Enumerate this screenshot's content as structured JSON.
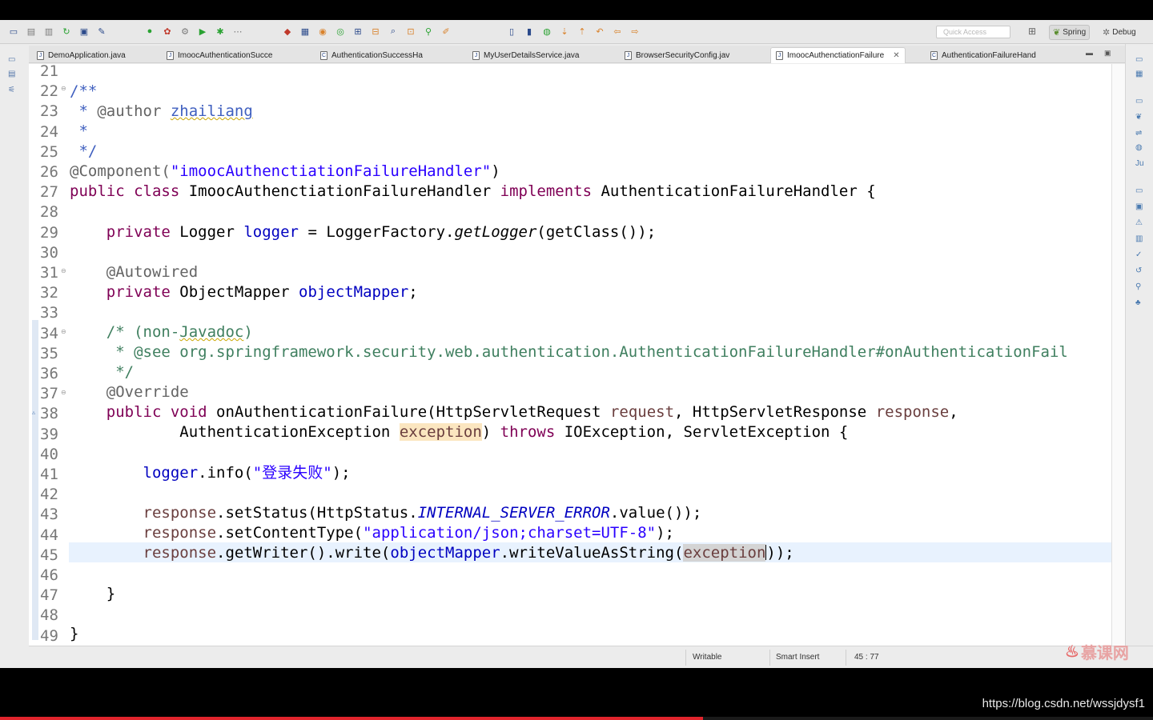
{
  "toolbar": {
    "quick_access_placeholder": "Quick Access",
    "perspectives": [
      {
        "label": "Spring",
        "icon": "spring-leaf-icon"
      },
      {
        "label": "Debug",
        "icon": "bug-icon"
      }
    ]
  },
  "tabs": [
    {
      "label": "DemoApplication.java"
    },
    {
      "label": "ImoocAuthenticationSucce"
    },
    {
      "label": "AuthenticationSuccessHa"
    },
    {
      "label": "MyUserDetailsService.java"
    },
    {
      "label": "BrowserSecurityConfig.jav"
    },
    {
      "label": "ImoocAuthenctiationFailure",
      "active": true
    },
    {
      "label": "AuthenticationFailureHand"
    }
  ],
  "editor": {
    "line_numbers": [
      "21",
      "22",
      "23",
      "24",
      "25",
      "26",
      "27",
      "28",
      "29",
      "30",
      "31",
      "32",
      "33",
      "34",
      "35",
      "36",
      "37",
      "38",
      "39",
      "40",
      "41",
      "42",
      "43",
      "44",
      "45",
      "46",
      "47",
      "48",
      "49"
    ],
    "code": {
      "l22": "/**",
      "l23a": " * ",
      "l23b": "@author",
      "l23c": " ",
      "l23d": "zhailiang",
      "l24": " *",
      "l25": " */",
      "l26a": "@Component(",
      "l26b": "\"imoocAuthenctiationFailureHandler\"",
      "l26c": ")",
      "l27a": "public class",
      "l27b": " ImoocAuthenctiationFailureHandler ",
      "l27c": "implements",
      "l27d": " AuthenticationFailureHandler {",
      "l29a": "    ",
      "l29b": "private",
      "l29c": " Logger ",
      "l29d": "logger",
      "l29e": " = LoggerFactory.",
      "l29f": "getLogger",
      "l29g": "(getClass());",
      "l31": "    @Autowired",
      "l32a": "    ",
      "l32b": "private",
      "l32c": " ObjectMapper ",
      "l32d": "objectMapper",
      "l32e": ";",
      "l34a": "    /* (non-",
      "l34b": "Javadoc",
      "l34c": ")",
      "l35": "     * @see org.springframework.security.web.authentication.AuthenticationFailureHandler#onAuthenticationFail",
      "l36": "     */",
      "l37": "    @Override",
      "l38a": "    ",
      "l38b": "public void",
      "l38c": " onAuthenticationFailure(HttpServletRequest ",
      "l38d": "request",
      "l38e": ", HttpServletResponse ",
      "l38f": "response",
      "l38g": ",",
      "l39a": "            AuthenticationException ",
      "l39b": "exception",
      "l39c": ") ",
      "l39d": "throws",
      "l39e": " IOException, ServletException {",
      "l41a": "        ",
      "l41b": "logger",
      "l41c": ".info(",
      "l41d": "\"登录失败\"",
      "l41e": ");",
      "l43a": "        ",
      "l43b": "response",
      "l43c": ".setStatus(HttpStatus.",
      "l43d": "INTERNAL_SERVER_ERROR",
      "l43e": ".value());",
      "l44a": "        ",
      "l44b": "response",
      "l44c": ".setContentType(",
      "l44d": "\"application/json;charset=UTF-8\"",
      "l44e": ");",
      "l45a": "        ",
      "l45b": "response",
      "l45c": ".getWriter().write(",
      "l45d": "objectMapper",
      "l45e": ".writeValueAsString(",
      "l45f": "exception",
      "l45g": "));",
      "l47": "    }",
      "l49": "}"
    }
  },
  "status": {
    "writable": "Writable",
    "insert_mode": "Smart Insert",
    "cursor_pos": "45 : 77"
  },
  "watermark": {
    "logo_text": "慕课网"
  },
  "footer": {
    "url": "https://blog.csdn.net/wssjdysf1"
  },
  "video_progress": 0.61
}
